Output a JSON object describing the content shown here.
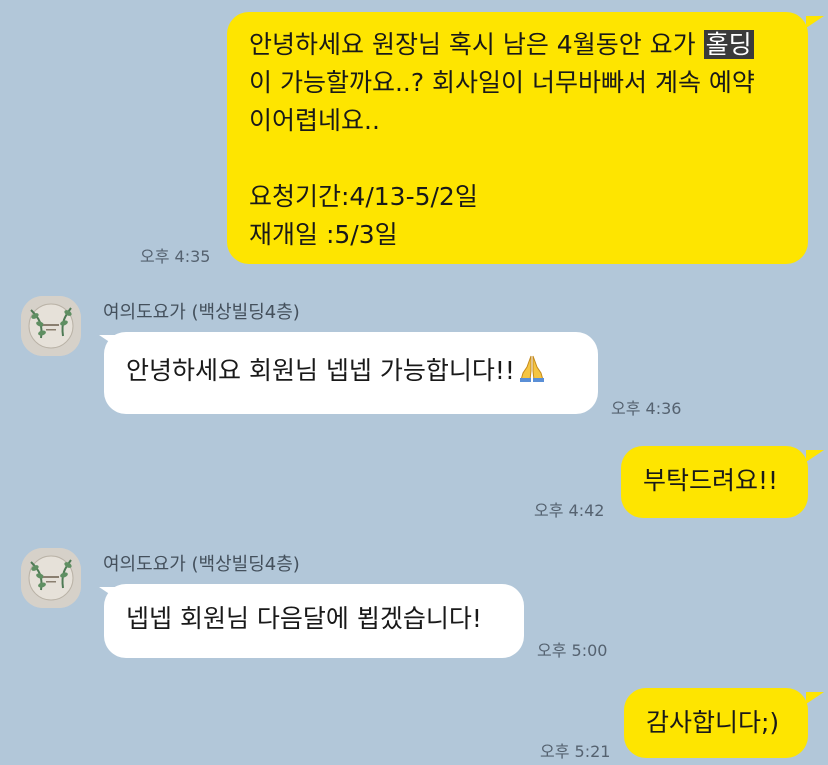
{
  "messages": [
    {
      "sender": "me",
      "line1_pre": "안녕하세요 원장님 혹시 남은 4월동안 요가 ",
      "line1_highlight": "홀딩",
      "rest": "이 가능할까요..? 회사일이 너무바빠서 계속 예약\n이어렵네요..\n\n요청기간:4/13-5/2일\n재개일 :5/3일",
      "time": "오후 4:35"
    },
    {
      "sender": "other",
      "name": "여의도요가 (백상빌딩4층)",
      "text": "안녕하세요 회원님 넵넵 가능합니다!!",
      "emoji": "folded-hands-emoji",
      "time": "오후 4:36"
    },
    {
      "sender": "me",
      "text": "부탁드려요!!",
      "time": "오후 4:42"
    },
    {
      "sender": "other",
      "name": "여의도요가 (백상빌딩4층)",
      "text": "넵넵 회원님 다음달에 뵙겠습니다!",
      "time": "오후 5:00"
    },
    {
      "sender": "me",
      "text": "감사합니다;)",
      "time": "오후 5:21"
    }
  ],
  "colors": {
    "background": "#b2c7d9",
    "my_bubble": "#fee500",
    "their_bubble": "#ffffff",
    "highlight": "#3a3a3a"
  },
  "avatar_icon": "yoga-studio-logo-avatar"
}
